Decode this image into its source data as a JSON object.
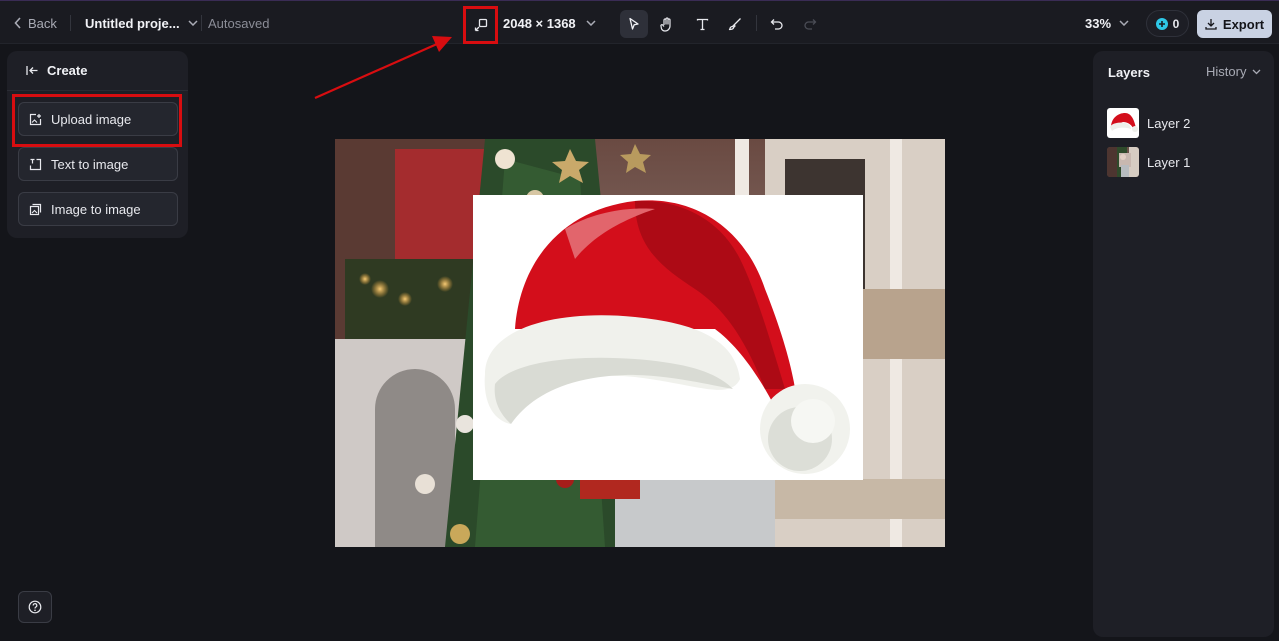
{
  "topbar": {
    "back_label": "Back",
    "project_name": "Untitled proje...",
    "autosaved": "Autosaved",
    "canvas_size": "2048 × 1368",
    "zoom": "33%",
    "credits": "0",
    "export_label": "Export",
    "tools": [
      {
        "name": "select-tool",
        "icon": "pointer-icon",
        "active": true
      },
      {
        "name": "hand-tool",
        "icon": "hand-icon",
        "active": false
      },
      {
        "name": "text-tool",
        "icon": "text-icon",
        "active": false
      },
      {
        "name": "brush-tool",
        "icon": "brush-icon",
        "active": false
      },
      {
        "name": "undo-button",
        "icon": "undo-icon",
        "active": false
      },
      {
        "name": "redo-button",
        "icon": "redo-icon",
        "active": false
      }
    ]
  },
  "left_panel": {
    "title": "Create",
    "buttons": [
      {
        "label": "Upload image",
        "icon": "upload-image-icon"
      },
      {
        "label": "Text to image",
        "icon": "text-to-image-icon"
      },
      {
        "label": "Image to image",
        "icon": "image-to-image-icon"
      }
    ]
  },
  "right_panel": {
    "tab_layers": "Layers",
    "tab_history": "History",
    "layers": [
      {
        "label": "Layer 2",
        "thumb": "santa-hat"
      },
      {
        "label": "Layer 1",
        "thumb": "christmas-photo"
      }
    ]
  },
  "colors": {
    "accent_red": "#d80d10",
    "background": "#14151a",
    "panel": "#1e1f26",
    "export_bg": "#c9d2e3"
  }
}
